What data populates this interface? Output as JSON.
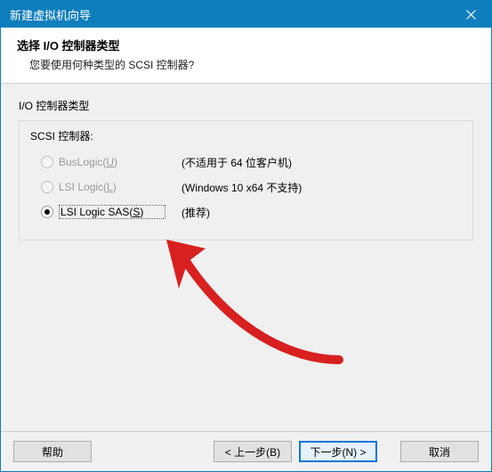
{
  "window": {
    "title": "新建虚拟机向导"
  },
  "header": {
    "title": "选择 I/O 控制器类型",
    "subtitle": "您要使用何种类型的 SCSI 控制器?"
  },
  "content": {
    "group_label": "I/O 控制器类型",
    "legend": "SCSI 控制器:",
    "options": [
      {
        "label": "BusLogic(",
        "hotkey": "U",
        "label_end": ")",
        "desc": "(不适用于 64 位客户机)",
        "disabled": true,
        "selected": false
      },
      {
        "label": "LSI Logic(",
        "hotkey": "L",
        "label_end": ")",
        "desc": "(Windows 10 x64 不支持)",
        "disabled": true,
        "selected": false
      },
      {
        "label": "LSI Logic SAS(",
        "hotkey": "S",
        "label_end": ")",
        "desc": "(推荐)",
        "disabled": false,
        "selected": true
      }
    ]
  },
  "footer": {
    "help": "帮助",
    "back": "< 上一步(B)",
    "next": "下一步(N) >",
    "cancel": "取消"
  }
}
